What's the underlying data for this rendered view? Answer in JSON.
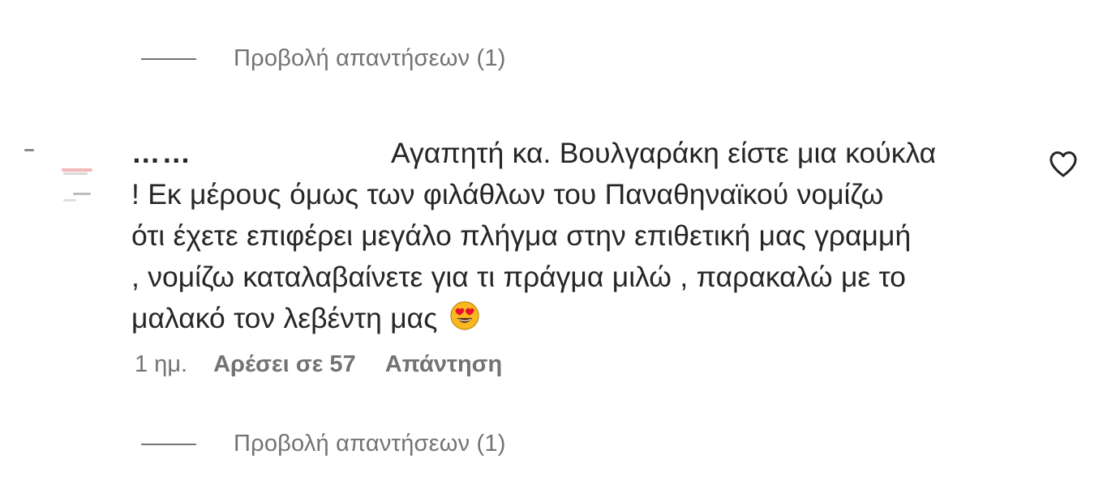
{
  "view_replies_top": {
    "label": "Προβολή απαντήσεων (1)"
  },
  "comment": {
    "username": "……",
    "text_lines": [
      "Αγαπητή κα. Βουλγαράκη είστε μια κούκλα",
      "! Εκ μέρους όμως των φιλάθλων του Παναθηναϊκού νομίζω",
      "ότι έχετε επιφέρει μεγάλο πλήγμα στην επιθετική μας γραμμή",
      ", νομίζω καταλαβαίνετε για τι πράγμα μιλώ , παρακαλώ με το",
      "μαλακό τον λεβέντη μας"
    ],
    "emoji": "smiling-face-with-heart-eyes",
    "time": "1 ημ.",
    "likes": "Αρέσει σε 57",
    "reply_label": "Απάντηση",
    "like_icon": "heart-outline-icon"
  },
  "view_replies_bottom": {
    "label": "Προβολή απαντήσεων (1)"
  },
  "colors": {
    "text": "#262626",
    "secondary": "#737373",
    "background": "#ffffff"
  }
}
